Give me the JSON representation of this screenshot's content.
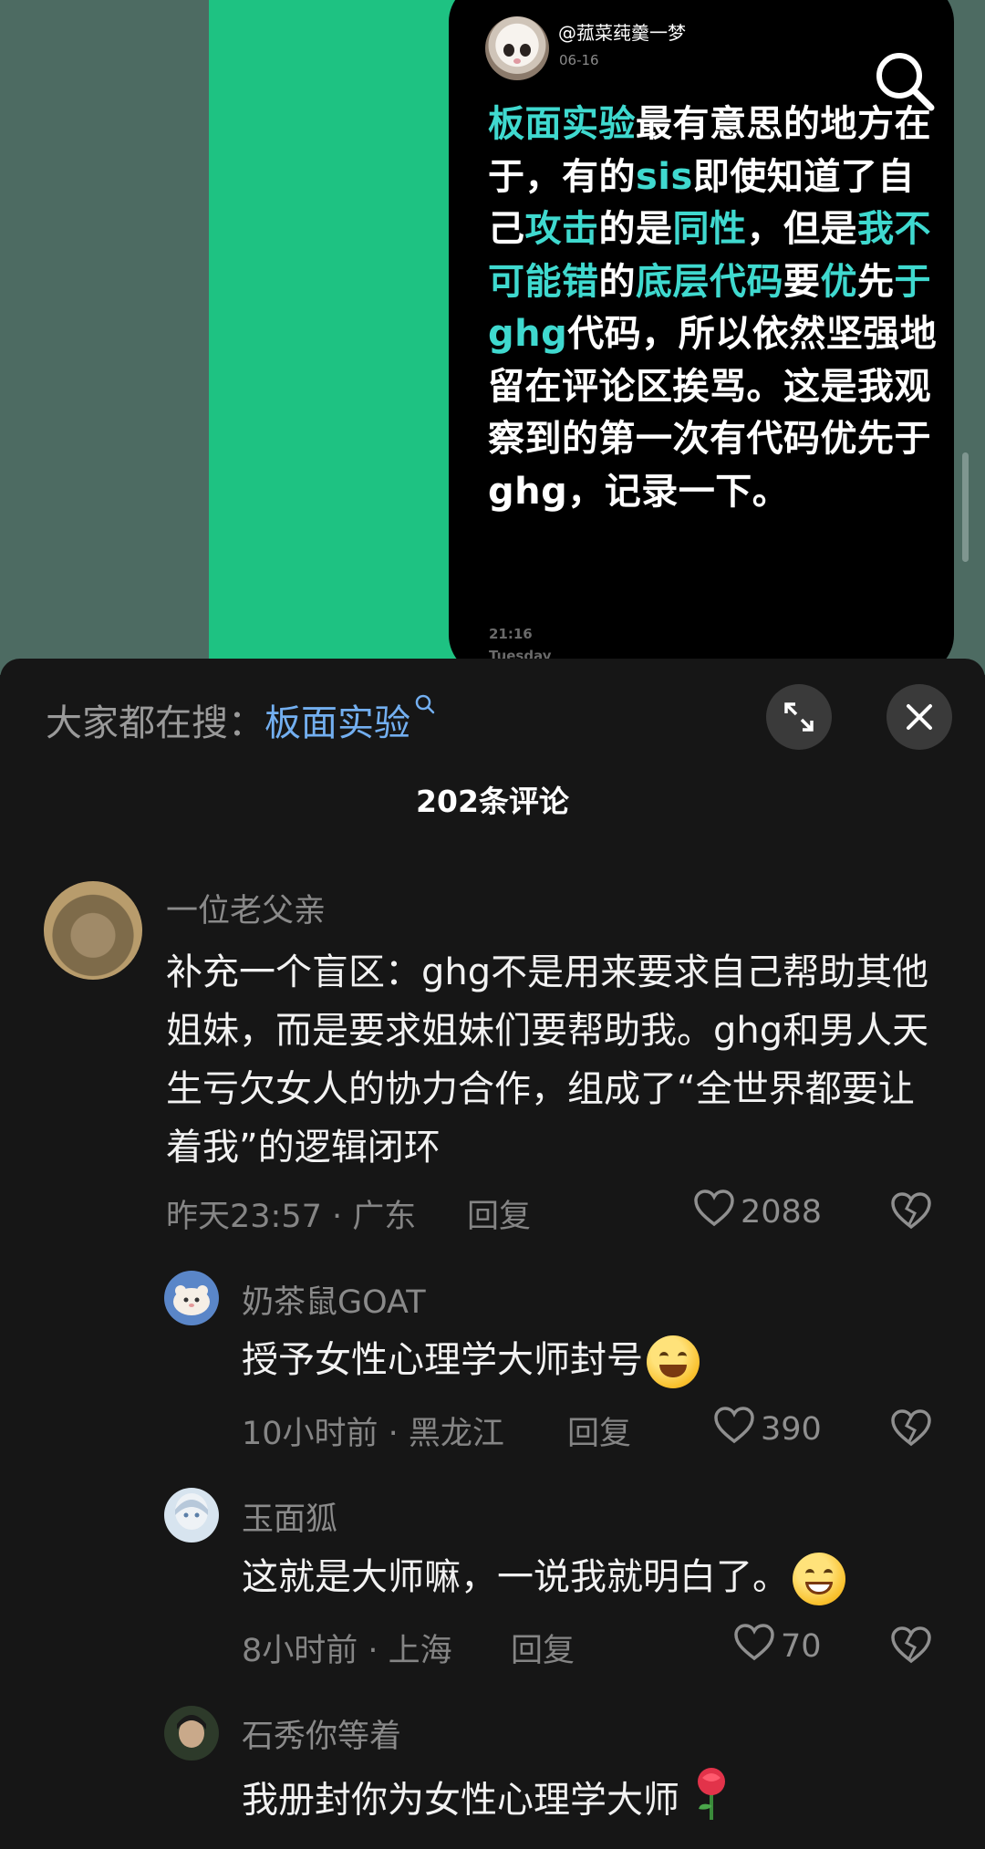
{
  "post": {
    "author": "@菰菜莼羹一梦",
    "date": "06-16",
    "text_segments": [
      {
        "t": "板面实验",
        "hl": true
      },
      {
        "t": "最有意思的地方在于，有的",
        "hl": false
      },
      {
        "t": "sis",
        "hl": true
      },
      {
        "t": "即使知道了自己",
        "hl": false
      },
      {
        "t": "攻击",
        "hl": true
      },
      {
        "t": "的是",
        "hl": false
      },
      {
        "t": "同性",
        "hl": true
      },
      {
        "t": "，但是",
        "hl": false
      },
      {
        "t": "我不可能错",
        "hl": true
      },
      {
        "t": "的",
        "hl": false
      },
      {
        "t": "底层代码",
        "hl": true
      },
      {
        "t": "要",
        "hl": false
      },
      {
        "t": "优",
        "hl": true
      },
      {
        "t": "先",
        "hl": false
      },
      {
        "t": "于ghg",
        "hl": true
      },
      {
        "t": "代码，所以依然坚强地留在评论区挨骂。这是我观察到的第一次有代码优先于ghg，记录一下。",
        "hl": false
      }
    ],
    "time": "21:16",
    "day": "Tuesday"
  },
  "sheet": {
    "search_prefix": "大家都在搜：",
    "search_term": "板面实验",
    "comment_count": "202条评论"
  },
  "comments": [
    {
      "name": "一位老父亲",
      "text": "补充一个盲区：ghg不是用来要求自己帮助其他姐妹，而是要求姐妹们要帮助我。ghg和男人天生亏欠女人的协力合作，组成了“全世界都要让着我”的逻辑闭环",
      "meta": "昨天23:57 · 广东",
      "reply": "回复",
      "likes": "2088"
    },
    {
      "name": "奶茶鼠GOAT",
      "text": "授予女性心理学大师封号",
      "meta": "10小时前 · 黑龙江",
      "reply": "回复",
      "likes": "390"
    },
    {
      "name": "玉面狐",
      "text": "这就是大师嘛，一说我就明白了。",
      "meta": "8小时前 · 上海",
      "reply": "回复",
      "likes": "70"
    },
    {
      "name": "石秀你等着",
      "text": "我册封你为女性心理学大师"
    }
  ]
}
